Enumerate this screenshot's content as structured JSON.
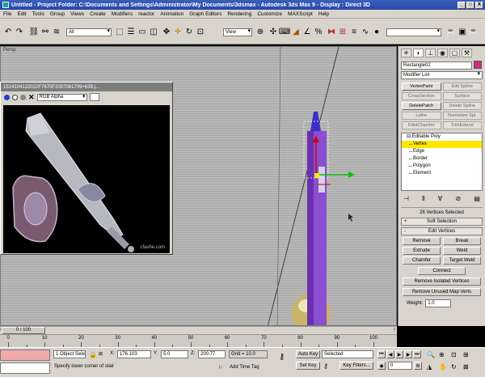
{
  "window": {
    "title": "Untitled   - Project Folder: C:\\Documents and Settings\\Administrator\\My Documents\\3dsmax      - Autodesk 3ds Max 9         - Display : Direct 3D",
    "min": "_",
    "max": "□",
    "close": "X"
  },
  "menu": [
    "File",
    "Edit",
    "Tools",
    "Group",
    "Views",
    "Create",
    "Modifiers",
    "reactor",
    "Animation",
    "Graph Editors",
    "Rendering",
    "Customize",
    "MAXScript",
    "Help"
  ],
  "toolbar": {
    "selection_filter": "All",
    "reference_coord": "View"
  },
  "viewport": {
    "label": "Persp"
  },
  "image_window": {
    "title": "1514104122022F7670F2007061709+639.j...",
    "channel": "RGB Alpha",
    "watermark": "cfashe.com"
  },
  "command_panel": {
    "object_name": "Rectangle02",
    "modifier_list": "Modifier List",
    "buttons": [
      {
        "label": "VertexPaint",
        "active": true
      },
      {
        "label": "Edit Spline",
        "active": false
      },
      {
        "label": "CrossSection",
        "active": false
      },
      {
        "label": "Surface",
        "active": false
      },
      {
        "label": "DeletePatch",
        "active": true
      },
      {
        "label": "Delete Spline",
        "active": false
      },
      {
        "label": "Lathe",
        "active": false
      },
      {
        "label": "Normalize Spl.",
        "active": false
      },
      {
        "label": "FilletChamfer",
        "active": false
      },
      {
        "label": "TrimExtend",
        "active": false
      }
    ],
    "stack": {
      "root": "Editable Poly",
      "items": [
        "Vertex",
        "Edge",
        "Border",
        "Polygon",
        "Element"
      ],
      "selected": "Vertex"
    },
    "selection_status": "26 Vertices Selected",
    "soft_selection": "Soft Selection",
    "edit_vertices": "Edit Vertices",
    "remove": "Remove",
    "break": "Break",
    "extrude": "Extrude",
    "weld": "Weld",
    "chamfer": "Chamfer",
    "target_weld": "Target Weld",
    "connect": "Connect",
    "remove_isolated": "Remove Isolated Vertices",
    "remove_unused": "Remove Unused Map Verts",
    "weight_label": "Weight:",
    "weight_value": "1.0"
  },
  "timeline": {
    "frame": "0 / 100",
    "ticks": [
      {
        "v": 0,
        "label": "0"
      },
      {
        "v": 10,
        "label": "10"
      },
      {
        "v": 20,
        "label": "20"
      },
      {
        "v": 30,
        "label": "30"
      },
      {
        "v": 40,
        "label": "40"
      },
      {
        "v": 50,
        "label": "50"
      },
      {
        "v": 60,
        "label": "60"
      },
      {
        "v": 70,
        "label": "70"
      },
      {
        "v": 80,
        "label": "80"
      },
      {
        "v": 90,
        "label": "90"
      },
      {
        "v": 100,
        "label": "100"
      }
    ]
  },
  "status": {
    "selection": "1 Object Sele",
    "prompt": "Specify lower corner of stair",
    "x_label": "X:",
    "x_value": "176.103",
    "y_label": "Y:",
    "y_value": "5.0",
    "z_label": "Z:",
    "z_value": "200.77",
    "grid": "Grid = 10.0",
    "add_time_tag": "Add Time Tag",
    "auto_key": "Auto Key",
    "set_key": "Set Key",
    "key_mode": "Selected",
    "key_filters": "Key Filters...",
    "current_frame": "0"
  },
  "colors": {
    "title_bar": "#2846a6",
    "ui_gray": "#d8d4cc",
    "selected_stack": "#ffe700",
    "object_color": "#cc2b78",
    "tower": "#8a4fd0"
  }
}
